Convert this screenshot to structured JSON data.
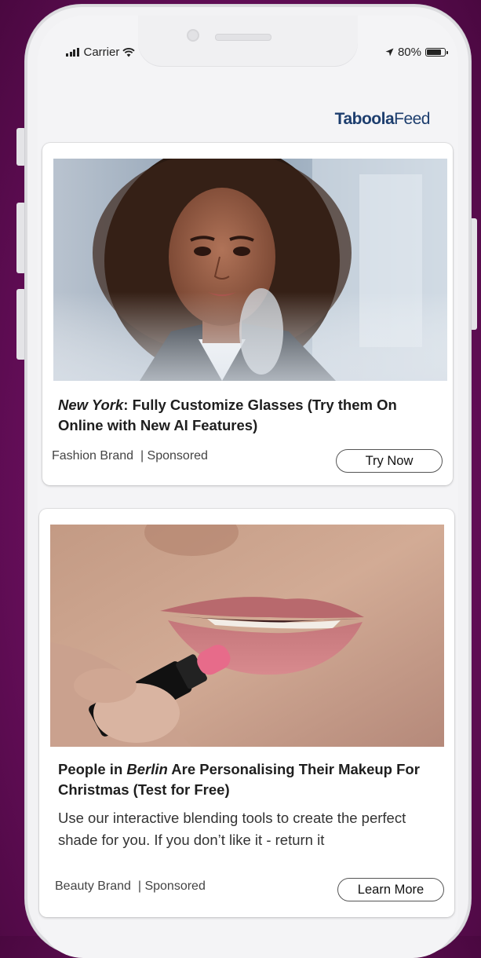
{
  "status_bar": {
    "carrier": "Carrier",
    "battery_percent": "80%",
    "battery_level": 0.8
  },
  "brand": {
    "name_bold": "Taboola",
    "name_light": "Feed"
  },
  "feed": [
    {
      "image_alt": "Woman with curly hair trying on glasses",
      "title_italic": "New York",
      "title_rest": ": Fully Customize Glasses (Try them On Online with New AI Features)",
      "source": "Fashion Brand",
      "sponsored": "| Sponsored",
      "cta": "Try Now"
    },
    {
      "image_alt": "Close-up of woman applying pink lipstick",
      "title_prefix": "People in ",
      "title_italic": "Berlin",
      "title_rest": " Are Personalising Their Makeup For Christmas (Test for Free)",
      "description": "Use our interactive blending tools to create the perfect shade for you. If you don’t like it - return it",
      "source": "Beauty Brand",
      "sponsored": "| Sponsored",
      "cta": "Learn More"
    }
  ]
}
